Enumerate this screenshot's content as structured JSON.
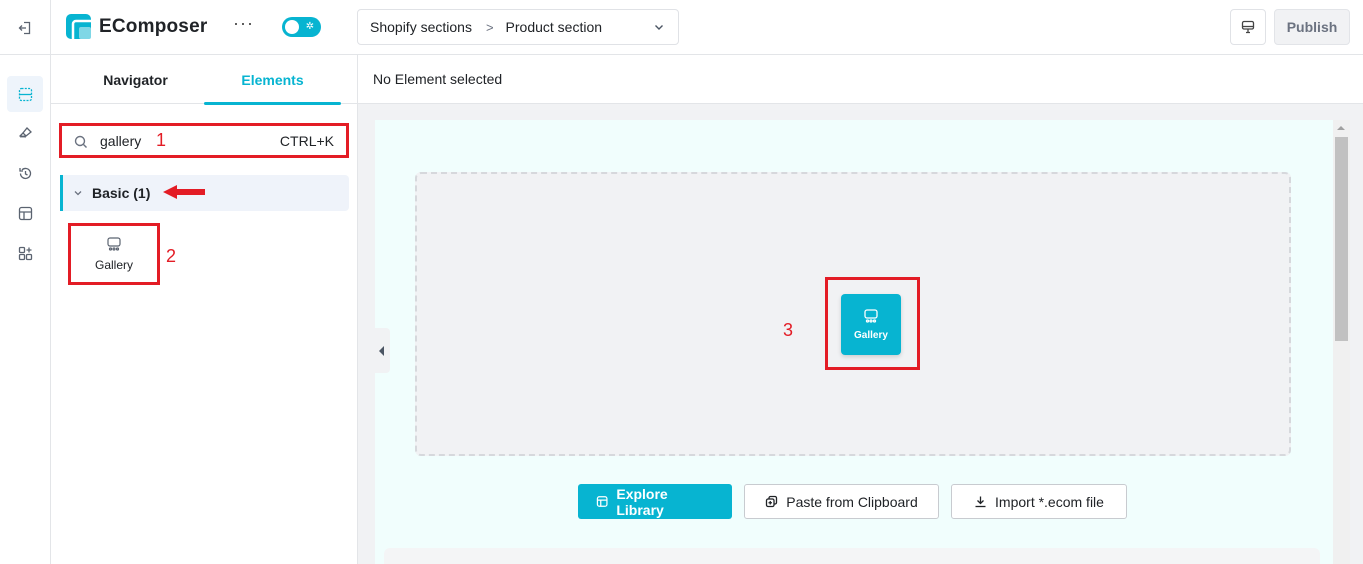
{
  "app": {
    "name": "EComposer",
    "brand_color": "#07b4d1",
    "annotation_color": "#e31c25"
  },
  "topbar": {
    "exit_icon": "exit-icon",
    "more_icon": "more-horizontal-icon",
    "theme_toggle": {
      "icon": "sun-icon",
      "on": true
    },
    "breadcrumb": {
      "parent": "Shopify sections",
      "current": "Product section"
    },
    "device_icon": "desktop-icon",
    "publish_label": "Publish"
  },
  "rail": {
    "items": [
      {
        "icon": "sections-icon",
        "active": true
      },
      {
        "icon": "brush-icon",
        "active": false
      },
      {
        "icon": "history-icon",
        "active": false
      },
      {
        "icon": "layout-icon",
        "active": false
      },
      {
        "icon": "apps-add-icon",
        "active": false
      }
    ]
  },
  "panel": {
    "tabs": [
      {
        "label": "Navigator",
        "active": false
      },
      {
        "label": "Elements",
        "active": true
      }
    ],
    "search": {
      "value": "gallery",
      "shortcut": "CTRL+K"
    },
    "group": {
      "label": "Basic (1)",
      "expanded": true
    },
    "elements": [
      {
        "label": "Gallery",
        "icon": "gallery-icon"
      }
    ]
  },
  "main": {
    "status": "No Element selected",
    "dropped_element": {
      "label": "Gallery",
      "icon": "gallery-icon"
    },
    "actions": {
      "explore": "Explore Library",
      "paste": "Paste from Clipboard",
      "import": "Import *.ecom file"
    }
  },
  "annotations": {
    "one": "1",
    "two": "2",
    "three": "3"
  }
}
